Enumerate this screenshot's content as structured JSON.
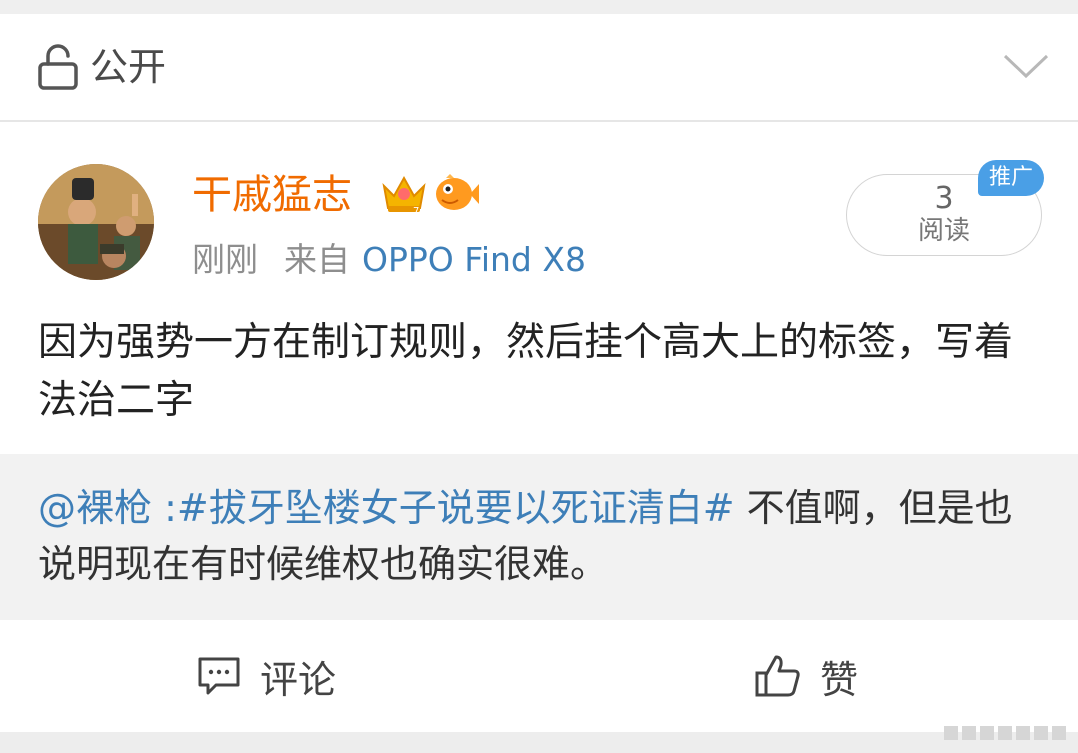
{
  "privacy": {
    "label": "公开",
    "icon": "lock-open-icon",
    "expand_icon": "chevron-down-icon"
  },
  "post": {
    "author": "干戚猛志",
    "badges": [
      "crown-badge-icon",
      "fish-badge-icon"
    ],
    "time": "刚刚",
    "via_label": "来自",
    "device": "OPPO Find X8",
    "read_count": "3",
    "read_label": "阅读",
    "promo_tag": "推广",
    "text": "因为强势一方在制订规则，然后挂个高大上的标签，写着法治二字"
  },
  "repost": {
    "mention": "@裸枪",
    "separator": " :",
    "topic": "#拔牙坠楼女子说要以死证清白#",
    "text": " 不值啊，但是也说明现在有时候维权也确实很难。"
  },
  "actions": {
    "comment_label": "评论",
    "like_label": "赞"
  },
  "colors": {
    "author": "#f06b00",
    "link": "#3e7fb8",
    "promo": "#4a9fe6"
  }
}
